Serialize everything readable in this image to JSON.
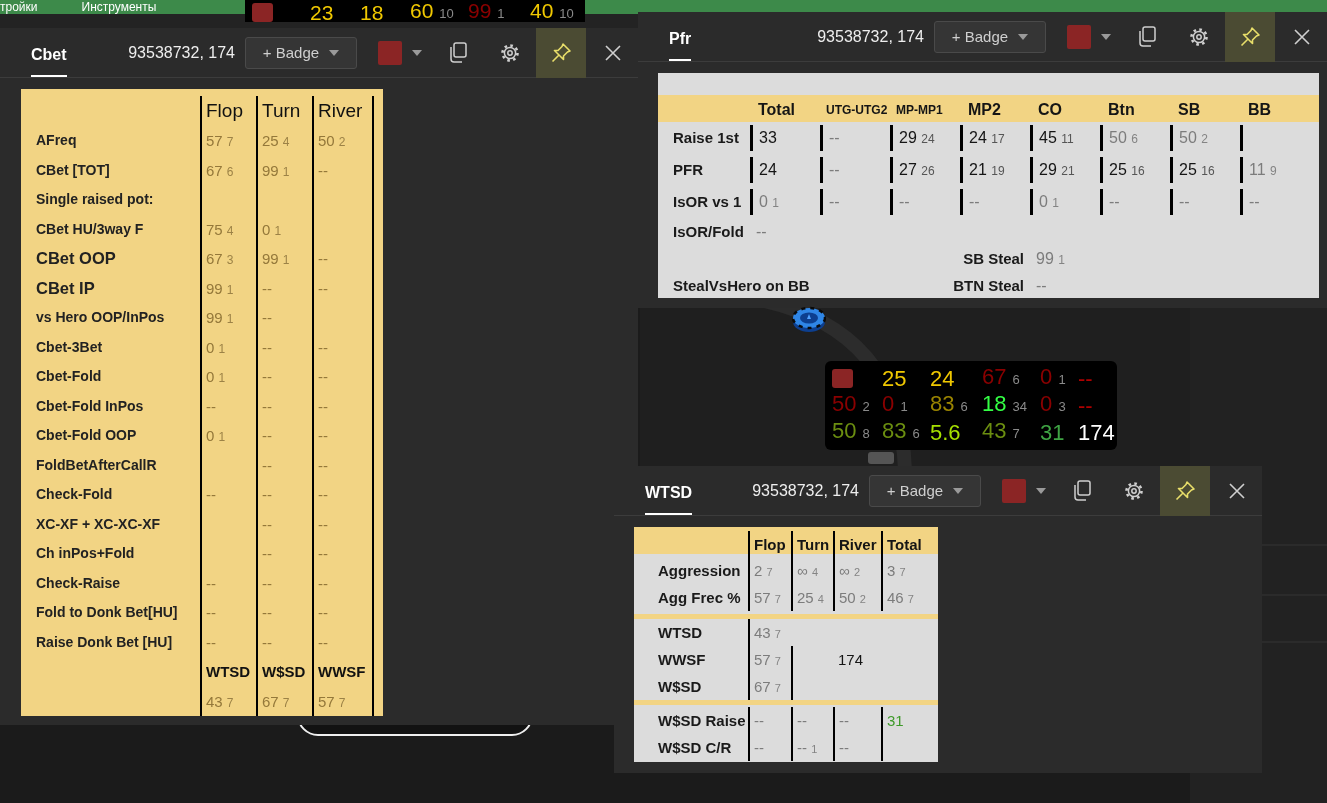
{
  "menu": {
    "items": [
      "тройки",
      "Инструменты"
    ]
  },
  "top_hud": {
    "stats": [
      {
        "kind": "marker",
        "color": "#8b2525"
      },
      {
        "kind": "stat",
        "value": "23",
        "color": "#f0c800"
      },
      {
        "kind": "stat",
        "value": "18",
        "color": "#f0c800"
      },
      {
        "kind": "stat",
        "value": "60",
        "sample": "10",
        "color": "#f0c800"
      },
      {
        "kind": "stat",
        "value": "99",
        "sample": "1",
        "color": "#8b0000"
      },
      {
        "kind": "stat",
        "value": "40",
        "sample": "10",
        "color": "#f0c800"
      }
    ]
  },
  "windows": [
    {
      "kind": "cbet",
      "title": "Cbet",
      "title_selected": true,
      "player": "93538732, 174",
      "badge_label": "+ Badge",
      "color": "#8b2525",
      "pinned": true,
      "table": {
        "columns": [
          "Flop",
          "Turn",
          "River"
        ],
        "rows": [
          {
            "label": "AFreq",
            "large": false,
            "cells": [
              {
                "value": "57",
                "sample": "7",
                "kind": "dim"
              },
              {
                "value": "25",
                "sample": "4",
                "kind": "dim"
              },
              {
                "value": "50",
                "sample": "2",
                "kind": "dim"
              }
            ]
          },
          {
            "label": "CBet [TOT]",
            "large": false,
            "cells": [
              {
                "value": "67",
                "sample": "6",
                "kind": "dim"
              },
              {
                "value": "99",
                "sample": "1",
                "kind": "dim"
              },
              {
                "value": "--",
                "kind": "dim"
              }
            ]
          },
          {
            "label": "Single raised pot:",
            "large": false,
            "cells": [
              null,
              null,
              null
            ]
          },
          {
            "label": "CBet HU/3way F",
            "large": false,
            "cells": [
              {
                "value": "75",
                "sample": "4",
                "kind": "dim"
              },
              {
                "value": "0",
                "sample": "1",
                "kind": "dim"
              },
              null
            ]
          },
          {
            "label": "CBet OOP",
            "large": true,
            "cells": [
              {
                "value": "67",
                "sample": "3",
                "kind": "dim"
              },
              {
                "value": "99",
                "sample": "1",
                "kind": "dim"
              },
              {
                "value": "--",
                "kind": "dim"
              }
            ]
          },
          {
            "label": "CBet IP",
            "large": true,
            "cells": [
              {
                "value": "99",
                "sample": "1",
                "kind": "dim"
              },
              {
                "value": "--",
                "kind": "dim"
              },
              {
                "value": "--",
                "kind": "dim"
              }
            ]
          },
          {
            "label": "vs Hero OOP/InPos",
            "large": false,
            "cells": [
              {
                "value": "99",
                "sample": "1",
                "kind": "dim"
              },
              {
                "value": "--",
                "kind": "dim"
              },
              null
            ]
          },
          {
            "label": "Cbet-3Bet",
            "large": false,
            "cells": [
              {
                "value": "0",
                "sample": "1",
                "kind": "dim"
              },
              {
                "value": "--",
                "kind": "dim"
              },
              {
                "value": "--",
                "kind": "dim"
              }
            ]
          },
          {
            "label": "Cbet-Fold",
            "large": false,
            "cells": [
              {
                "value": "0",
                "sample": "1",
                "kind": "dim"
              },
              {
                "value": "--",
                "kind": "dim"
              },
              {
                "value": "--",
                "kind": "dim"
              }
            ]
          },
          {
            "label": "Cbet-Fold InPos",
            "large": false,
            "cells": [
              {
                "value": "--",
                "kind": "dim"
              },
              {
                "value": "--",
                "kind": "dim"
              },
              {
                "value": "--",
                "kind": "dim"
              }
            ]
          },
          {
            "label": "Cbet-Fold OOP",
            "large": false,
            "cells": [
              {
                "value": "0",
                "sample": "1",
                "kind": "dim"
              },
              {
                "value": "--",
                "kind": "dim"
              },
              {
                "value": "--",
                "kind": "dim"
              }
            ]
          },
          {
            "label": "FoldBetAfterCallR",
            "large": false,
            "cells": [
              null,
              {
                "value": "--",
                "kind": "dim"
              },
              {
                "value": "--",
                "kind": "dim"
              }
            ]
          },
          {
            "label": "Check-Fold",
            "large": false,
            "cells": [
              {
                "value": "--",
                "kind": "dim"
              },
              {
                "value": "--",
                "kind": "dim"
              },
              {
                "value": "--",
                "kind": "dim"
              }
            ]
          },
          {
            "label": "XC-XF + XC-XC-XF",
            "large": false,
            "cells": [
              null,
              {
                "value": "--",
                "kind": "dim"
              },
              {
                "value": "--",
                "kind": "dim"
              }
            ]
          },
          {
            "label": "Ch inPos+Fold",
            "large": false,
            "cells": [
              null,
              {
                "value": "--",
                "kind": "dim"
              },
              {
                "value": "--",
                "kind": "dim"
              }
            ]
          },
          {
            "label": "Check-Raise",
            "large": false,
            "cells": [
              {
                "value": "--",
                "kind": "dim"
              },
              {
                "value": "--",
                "kind": "dim"
              },
              {
                "value": "--",
                "kind": "dim"
              }
            ]
          },
          {
            "label": "Fold to Donk Bet[HU]",
            "large": false,
            "cells": [
              {
                "value": "--",
                "kind": "dim"
              },
              {
                "value": "--",
                "kind": "dim"
              },
              {
                "value": "--",
                "kind": "dim"
              }
            ]
          },
          {
            "label": "Raise Donk Bet [HU]",
            "large": false,
            "cells": [
              {
                "value": "--",
                "kind": "dim"
              },
              {
                "value": "--",
                "kind": "dim"
              },
              {
                "value": "--",
                "kind": "dim"
              }
            ]
          }
        ],
        "footer": {
          "columns": [
            "WTSD",
            "W$SD",
            "WWSF"
          ],
          "cells": [
            {
              "value": "43",
              "sample": "7",
              "kind": "dim"
            },
            {
              "value": "67",
              "sample": "7",
              "kind": "dim"
            },
            {
              "value": "57",
              "sample": "7",
              "kind": "dim"
            }
          ]
        }
      }
    },
    {
      "kind": "pfr",
      "title": "Pfr",
      "title_selected": true,
      "player": "93538732, 174",
      "badge_label": "+ Badge",
      "color": "#8b2525",
      "pinned": true,
      "table": {
        "columns": [
          {
            "label": "Total",
            "compact": false
          },
          {
            "label": "UTG-UTG2",
            "compact": true
          },
          {
            "label": "MP-MP1",
            "compact": true
          },
          {
            "label": "MP2",
            "compact": false
          },
          {
            "label": "CO",
            "compact": false
          },
          {
            "label": "Btn",
            "compact": false
          },
          {
            "label": "SB",
            "compact": false
          },
          {
            "label": "BB",
            "compact": false
          }
        ],
        "rows": [
          {
            "label": "Raise 1st",
            "cells": [
              {
                "value": "33",
                "kind": "plain"
              },
              {
                "value": "--",
                "kind": "dim"
              },
              {
                "value": "29",
                "sample": "24",
                "kind": "plain"
              },
              {
                "value": "24",
                "sample": "17",
                "kind": "plain"
              },
              {
                "value": "45",
                "sample": "11",
                "kind": "plain"
              },
              {
                "value": "50",
                "sample": "6",
                "kind": "dim"
              },
              {
                "value": "50",
                "sample": "2",
                "kind": "dim"
              },
              null
            ]
          },
          {
            "label": "PFR",
            "cells": [
              {
                "value": "24",
                "kind": "plain"
              },
              {
                "value": "--",
                "kind": "dim"
              },
              {
                "value": "27",
                "sample": "26",
                "kind": "plain"
              },
              {
                "value": "21",
                "sample": "19",
                "kind": "plain"
              },
              {
                "value": "29",
                "sample": "21",
                "kind": "plain"
              },
              {
                "value": "25",
                "sample": "16",
                "kind": "plain"
              },
              {
                "value": "25",
                "sample": "16",
                "kind": "plain"
              },
              {
                "value": "11",
                "sample": "9",
                "kind": "dim"
              }
            ]
          },
          {
            "label": "IsOR vs 1",
            "cells": [
              {
                "value": "0",
                "sample": "1",
                "kind": "dim"
              },
              {
                "value": "--",
                "kind": "dim"
              },
              {
                "value": "--",
                "kind": "dim"
              },
              {
                "value": "--",
                "kind": "dim"
              },
              {
                "value": "0",
                "sample": "1",
                "kind": "dim"
              },
              {
                "value": "--",
                "kind": "dim"
              },
              {
                "value": "--",
                "kind": "dim"
              },
              {
                "value": "--",
                "kind": "dim"
              }
            ]
          }
        ],
        "extra": [
          {
            "kind": "single",
            "label": "IsOR/Fold",
            "cell": {
              "value": "--",
              "kind": "dim"
            }
          },
          {
            "kind": "steal",
            "right_label": "SB Steal",
            "cell": {
              "value": "99",
              "sample": "1",
              "kind": "dim"
            }
          },
          {
            "kind": "steal",
            "label": "StealVsHero on BB",
            "right_label": "BTN Steal",
            "cell": {
              "value": "--",
              "kind": "dim"
            }
          }
        ]
      }
    },
    {
      "kind": "wtsd",
      "title": "WTSD",
      "title_selected": true,
      "player": "93538732, 174",
      "badge_label": "+ Badge",
      "color": "#8b2525",
      "pinned": true,
      "table": {
        "columns": [
          "Flop",
          "Turn",
          "River",
          "Total"
        ],
        "sections": [
          {
            "rows": [
              {
                "label": "Aggression",
                "cells": [
                  {
                    "value": "2",
                    "sample": "7",
                    "kind": "dim"
                  },
                  {
                    "value": "∞",
                    "sample": "4",
                    "kind": "dim"
                  },
                  {
                    "value": "∞",
                    "sample": "2",
                    "kind": "dim"
                  },
                  {
                    "value": "3",
                    "sample": "7",
                    "kind": "dim"
                  }
                ]
              },
              {
                "label": "Agg Frec %",
                "cells": [
                  {
                    "value": "57",
                    "sample": "7",
                    "kind": "dim"
                  },
                  {
                    "value": "25",
                    "sample": "4",
                    "kind": "dim"
                  },
                  {
                    "value": "50",
                    "sample": "2",
                    "kind": "dim"
                  },
                  {
                    "value": "46",
                    "sample": "7",
                    "kind": "dim"
                  }
                ]
              }
            ]
          },
          {
            "note": "174",
            "rows": [
              {
                "label": "WTSD",
                "cells": [
                  {
                    "value": "43",
                    "sample": "7",
                    "kind": "dim"
                  }
                ]
              },
              {
                "label": "WWSF",
                "cells": [
                  {
                    "value": "57",
                    "sample": "7",
                    "kind": "dim"
                  }
                ]
              },
              {
                "label": "W$SD",
                "cells": [
                  {
                    "value": "67",
                    "sample": "7",
                    "kind": "dim"
                  }
                ]
              }
            ]
          },
          {
            "rows": [
              {
                "label": "W$SD Raise",
                "cells": [
                  {
                    "value": "--",
                    "kind": "dim"
                  },
                  {
                    "value": "--",
                    "kind": "dim"
                  },
                  {
                    "value": "--",
                    "kind": "dim"
                  },
                  {
                    "value": "31",
                    "kind": "highlight"
                  }
                ]
              },
              {
                "label": "W$SD C/R",
                "cells": [
                  {
                    "value": "--",
                    "kind": "dim"
                  },
                  {
                    "value": "--",
                    "sample": "1",
                    "kind": "dim"
                  },
                  {
                    "value": "--",
                    "kind": "dim"
                  },
                  null
                ]
              }
            ]
          }
        ]
      }
    }
  ],
  "table_hud": {
    "rows": [
      [
        {
          "kind": "marker",
          "color": "#8b2525"
        },
        {
          "kind": "stat",
          "value": "25",
          "color": "#f0c800"
        },
        {
          "kind": "stat",
          "value": "24",
          "color": "#f0c800"
        },
        {
          "kind": "stat",
          "value": "67",
          "sample": "6",
          "color": "#8b0000"
        },
        {
          "kind": "stat",
          "value": "0",
          "sample": "1",
          "color": "#8b0000"
        },
        {
          "kind": "stat",
          "value": "--",
          "color": "#b00000"
        }
      ],
      [
        {
          "kind": "stat",
          "value": "50",
          "sample": "2",
          "color": "#8b0000"
        },
        {
          "kind": "stat",
          "value": "0",
          "sample": "1",
          "color": "#8b0000"
        },
        {
          "kind": "stat",
          "value": "83",
          "sample": "6",
          "color": "#9a8400"
        },
        {
          "kind": "stat",
          "value": "18",
          "sample": "34",
          "color": "#33ff44"
        },
        {
          "kind": "stat",
          "value": "0",
          "sample": "3",
          "color": "#8b0000"
        },
        {
          "kind": "stat",
          "value": "--",
          "color": "#b00000"
        }
      ],
      [
        {
          "kind": "stat",
          "value": "50",
          "sample": "8",
          "color": "#6b8e10"
        },
        {
          "kind": "stat",
          "value": "83",
          "sample": "6",
          "color": "#6b8e10"
        },
        {
          "kind": "stat",
          "value": "5.6",
          "color": "#a6e000"
        },
        {
          "kind": "stat",
          "value": "43",
          "sample": "7",
          "color": "#6b8e10"
        },
        {
          "kind": "stat",
          "value": "31",
          "color": "#3fa444"
        },
        {
          "kind": "stat",
          "value": "174",
          "color": "#ffffff"
        }
      ]
    ]
  }
}
